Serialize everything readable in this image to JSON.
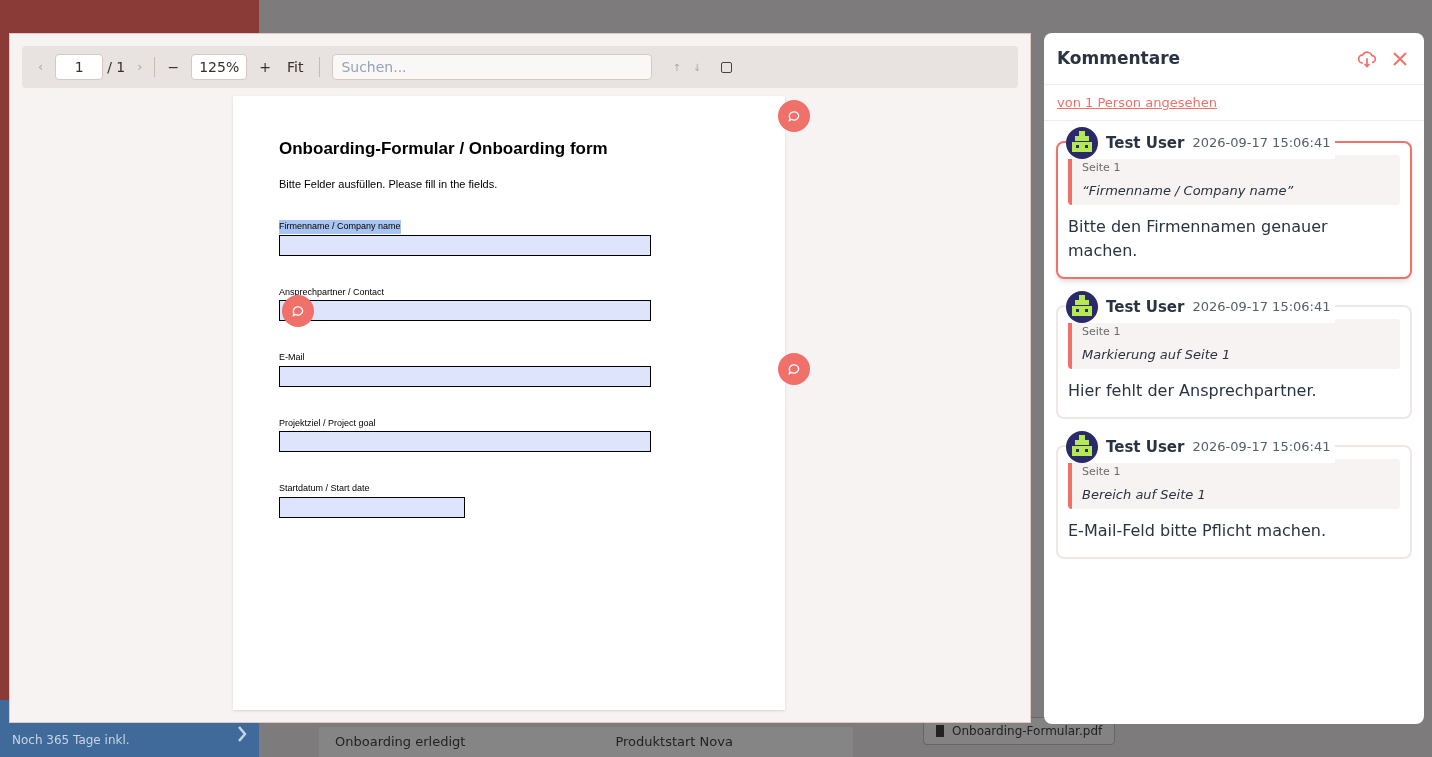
{
  "background": {
    "sidebar": {
      "upgrade_note": "Noch 365 Tage inkl."
    },
    "table_row": [
      "Onboarding erledigt",
      "Produktstart Nova"
    ],
    "attachment": "Onboarding-Formular.pdf"
  },
  "viewer": {
    "toolbar": {
      "prev": "‹",
      "page": "1",
      "page_total": "/ 1",
      "next": "›",
      "zoom_out": "−",
      "zoom": "125%",
      "zoom_in": "+",
      "fit": "Fit",
      "search_placeholder": "Suchen...",
      "up": "↑",
      "down": "↓"
    },
    "document": {
      "title": "Onboarding-Formular / Onboarding form",
      "intro": "Bitte Felder ausfüllen. Please fill in the fields.",
      "fields": [
        {
          "label": "Firmenname / Company name",
          "highlighted": true,
          "kind": "wide"
        },
        {
          "label": "Ansprechpartner / Contact",
          "highlighted": false,
          "kind": "wide"
        },
        {
          "label": "E-Mail",
          "highlighted": false,
          "kind": "wide"
        },
        {
          "label": "Projektziel / Project goal",
          "highlighted": false,
          "kind": "wide"
        },
        {
          "label": "Startdatum / Start date",
          "highlighted": false,
          "kind": "short"
        }
      ]
    }
  },
  "comments": {
    "title": "Kommentare",
    "seen_by": "von 1 Person angesehen",
    "items": [
      {
        "author": "Test User",
        "time": "2026-09-17 15:06:41",
        "page": "Seite 1",
        "quote": "“Firmenname / Company name”",
        "text": "Bitte den Firmennamen genauer machen.",
        "selected": true
      },
      {
        "author": "Test User",
        "time": "2026-09-17 15:06:41",
        "page": "Seite 1",
        "quote": "Markierung auf Seite 1",
        "text": "Hier fehlt der Ansprechpartner.",
        "selected": false
      },
      {
        "author": "Test User",
        "time": "2026-09-17 15:06:41",
        "page": "Seite 1",
        "quote": "Bereich auf Seite 1",
        "text": "E-Mail-Feld bitte Pflicht machen.",
        "selected": false
      }
    ]
  }
}
